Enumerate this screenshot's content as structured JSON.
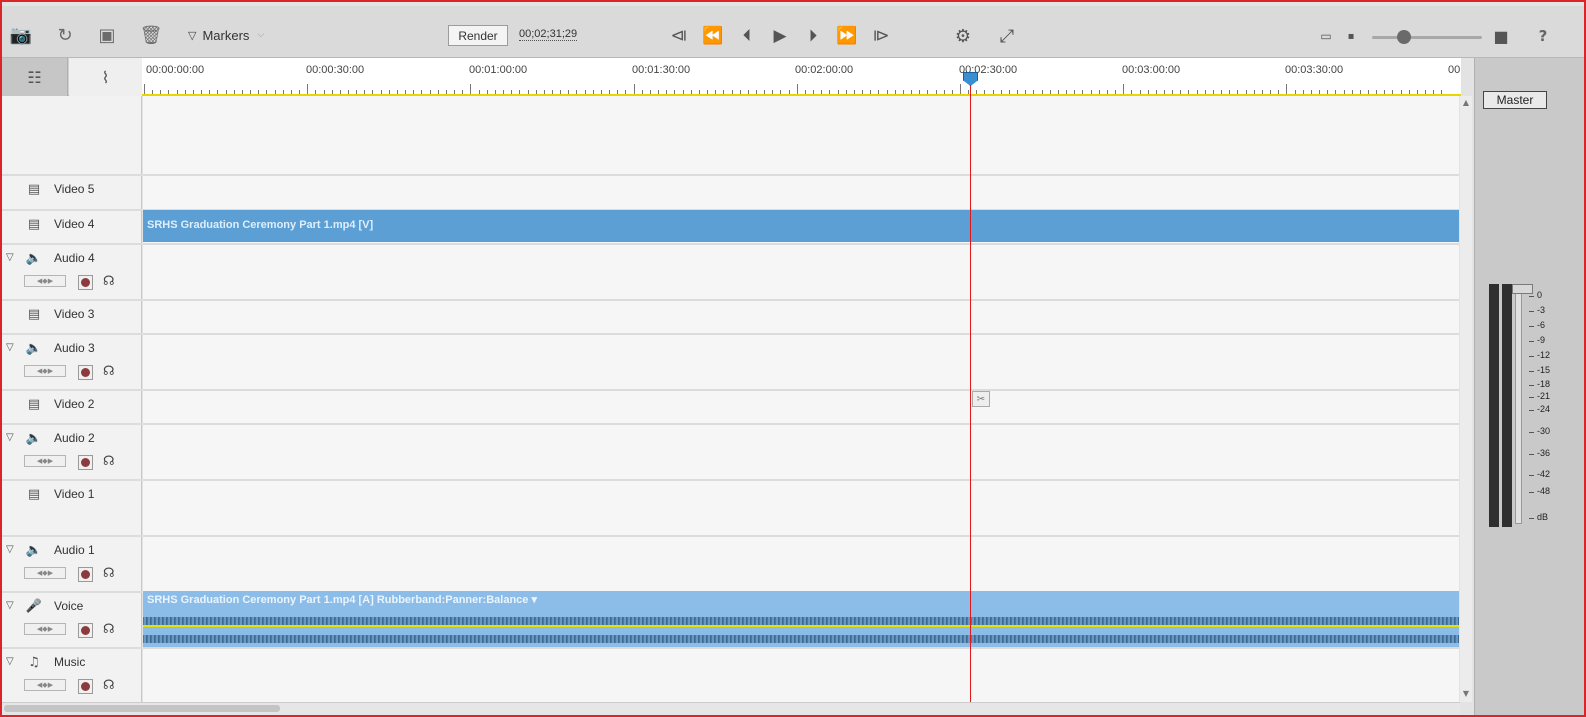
{
  "toolbar": {
    "icons": [
      "camera-add-icon",
      "rotate-icon",
      "smart-fix-icon",
      "trash-icon"
    ],
    "markers_label": "Markers",
    "render_label": "Render",
    "timecode": "00;02;31;29",
    "transport_icons": [
      "go-to-start-icon",
      "rewind-icon",
      "step-back-icon",
      "play-icon",
      "step-forward-icon",
      "fast-forward-icon",
      "go-to-end-icon"
    ],
    "right_icons": [
      "preview-settings-icon",
      "fit-to-window-icon",
      "zoom-out-icon",
      "zoom-in-icon",
      "help-icon"
    ],
    "help_glyph": "?"
  },
  "view_tabs": [
    "timeline-view-icon",
    "audio-waveform-icon"
  ],
  "ruler": {
    "labels": [
      "00:00:00:00",
      "00:00:30:00",
      "00:01:00:00",
      "00:01:30:00",
      "00:02:00:00",
      "00:02:30:00",
      "00:03:00:00",
      "00:03:30:00",
      "00"
    ]
  },
  "tracks": [
    {
      "name": "Video 5",
      "type": "video"
    },
    {
      "name": "Video 4",
      "type": "video"
    },
    {
      "name": "Audio 4",
      "type": "audio"
    },
    {
      "name": "Video 3",
      "type": "video"
    },
    {
      "name": "Audio 3",
      "type": "audio"
    },
    {
      "name": "Video 2",
      "type": "video"
    },
    {
      "name": "Audio 2",
      "type": "audio"
    },
    {
      "name": "Video 1",
      "type": "video"
    },
    {
      "name": "Audio 1",
      "type": "audio"
    },
    {
      "name": "Voice",
      "type": "voice"
    },
    {
      "name": "Music",
      "type": "music"
    }
  ],
  "clips": {
    "video": "SRHS Graduation Ceremony Part 1.mp4 [V]",
    "audio": "SRHS Graduation Ceremony Part 1.mp4 [A] Rubberband:Panner:Balance ▾"
  },
  "mixer": {
    "master_label": "Master",
    "db_scale": [
      "0",
      "-3",
      "-6",
      "-9",
      "-12",
      "-15",
      "-18",
      "-21",
      "-24",
      "-30",
      "-36",
      "-42",
      "-48",
      "dB"
    ]
  },
  "colors": {
    "playhead": "#e01a1a",
    "clip_video": "#5c9fd4",
    "clip_audio": "#8cbde8",
    "ruler_line": "#e8d600"
  }
}
